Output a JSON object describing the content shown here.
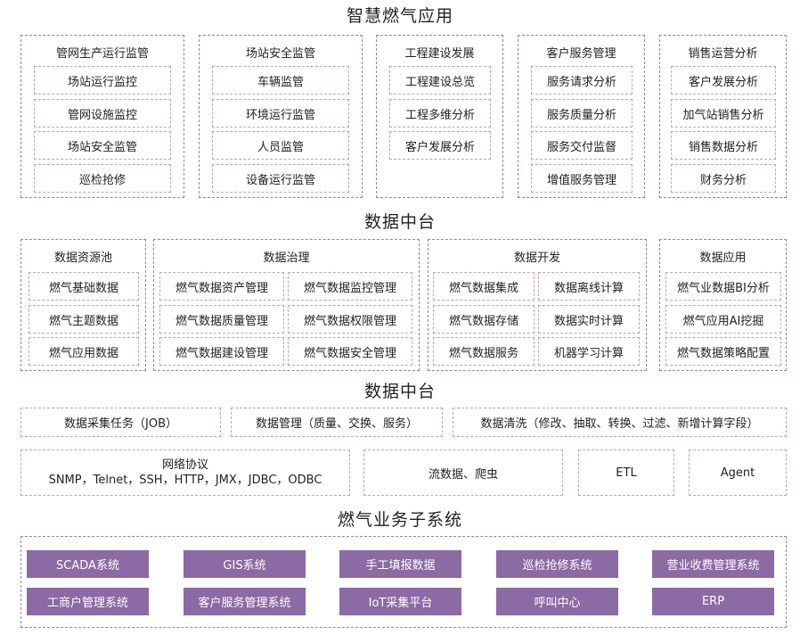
{
  "titles": {
    "smart_gas": "智慧燃气应用",
    "data_platform_1": "数据中台",
    "data_platform_2": "数据中台",
    "subsystem": "燃气业务子系统"
  },
  "app_layer": [
    {
      "label": "管网生产运行监管",
      "items": [
        "场站运行监控",
        "管网设施监控",
        "场站安全监管",
        "巡检抢修"
      ]
    },
    {
      "label": "场站安全监管",
      "items": [
        "车辆监管",
        "环境运行监管",
        "人员监管",
        "设备运行监管"
      ]
    },
    {
      "label": "工程建设发展",
      "items": [
        "工程建设总览",
        "工程多维分析",
        "客户发展分析"
      ]
    },
    {
      "label": "客户服务管理",
      "items": [
        "服务请求分析",
        "服务质量分析",
        "服务交付监督",
        "增值服务管理"
      ]
    },
    {
      "label": "销售运营分析",
      "items": [
        "客户发展分析",
        "加气站销售分析",
        "销售数据分析",
        "财务分析"
      ]
    }
  ],
  "data_layer": [
    {
      "label": "数据资源池",
      "items": [
        "燃气基础数据",
        "燃气主题数据",
        "燃气应用数据"
      ]
    },
    {
      "label": "数据治理",
      "items": [
        "燃气数据资产管理",
        "燃气数据监控管理",
        "燃气数据质量管理",
        "燃气数据权限管理",
        "燃气数据建设管理",
        "燃气数据安全管理"
      ]
    },
    {
      "label": "数据开发",
      "items": [
        "燃气数据集成",
        "数据离线计算",
        "燃气数据存储",
        "数据实时计算",
        "燃气数据服务",
        "机器学习计算"
      ]
    },
    {
      "label": "数据应用",
      "items": [
        "燃气业数据BI分析",
        "燃气应用AI挖掘",
        "燃气数据策略配置"
      ]
    }
  ],
  "tasks": [
    "数据采集任务（JOB）",
    "数据管理（质量、交换、服务）",
    "数据清洗（修改、抽取、转换、过滤、新增计算字段）"
  ],
  "sources": {
    "network_title": "网络协议",
    "network_protocols": "SNMP，Telnet，SSH，HTTP，JMX，JDBC，ODBC",
    "stream": "流数据、爬虫",
    "etl": "ETL",
    "agent": "Agent"
  },
  "systems": [
    "SCADA系统",
    "GIS系统",
    "手工填报数据",
    "巡检抢修系统",
    "营业收费管理系统",
    "工商户管理系统",
    "客户服务管理系统",
    "IoT采集平台",
    "呼叫中心",
    "ERP"
  ],
  "colors": {
    "accent": "#8c6aa3",
    "dashed_border": "#9a7fb5"
  }
}
